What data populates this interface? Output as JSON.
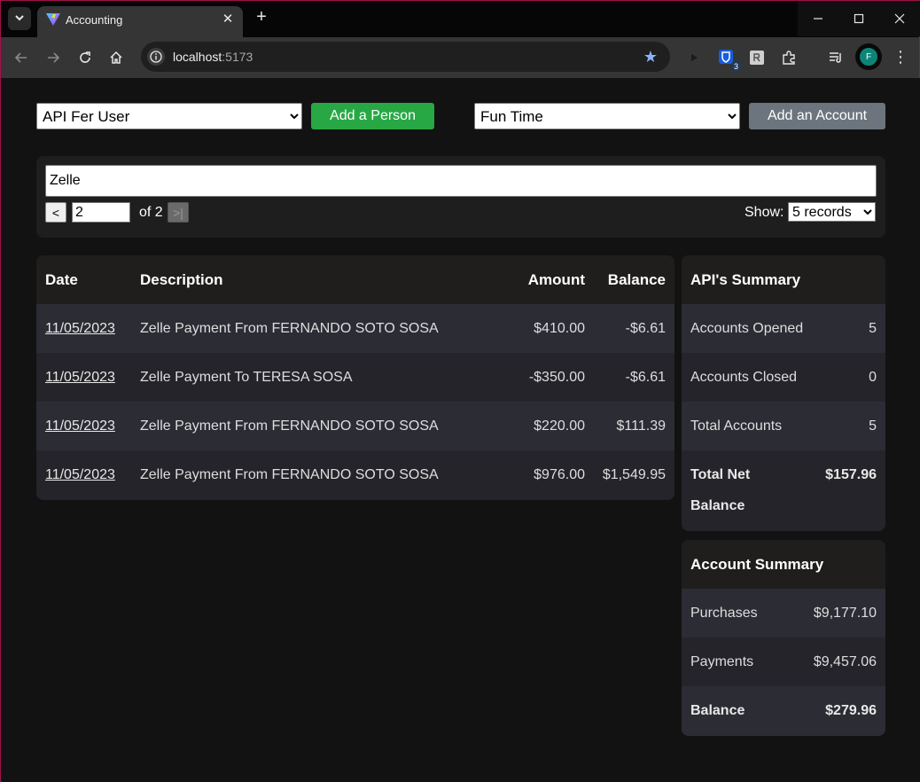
{
  "browser": {
    "tab_title": "Accounting",
    "url_host": "localhost",
    "url_port": ":5173",
    "extension_badge": "3",
    "profile_initial": "F"
  },
  "controls": {
    "person_select": "API Fer User",
    "add_person_label": "Add a Person",
    "account_select": "Fun Time",
    "add_account_label": "Add an Account"
  },
  "filter": {
    "search_value": "Zelle",
    "page_value": "2",
    "prev_label": "<",
    "next_label": ">|",
    "of_text": "of 2",
    "show_label": "Show:",
    "show_select": "5 records"
  },
  "table": {
    "headers": {
      "date": "Date",
      "description": "Description",
      "amount": "Amount",
      "balance": "Balance"
    },
    "rows": [
      {
        "date": "11/05/2023",
        "description": "Zelle Payment From FERNANDO SOTO SOSA",
        "amount": "$410.00",
        "balance": "-$6.61"
      },
      {
        "date": "11/05/2023",
        "description": "Zelle Payment To TERESA SOSA",
        "amount": "-$350.00",
        "balance": "-$6.61"
      },
      {
        "date": "11/05/2023",
        "description": "Zelle Payment From FERNANDO SOTO SOSA",
        "amount": "$220.00",
        "balance": "$111.39"
      },
      {
        "date": "11/05/2023",
        "description": "Zelle Payment From FERNANDO SOTO SOSA",
        "amount": "$976.00",
        "balance": "$1,549.95"
      }
    ]
  },
  "api_summary": {
    "title": "API's Summary",
    "rows": [
      {
        "label": "Accounts Opened",
        "value": "5"
      },
      {
        "label": "Accounts Closed",
        "value": "0"
      },
      {
        "label": "Total Accounts",
        "value": "5"
      }
    ],
    "net_label_line1": "Total Net",
    "net_label_line2": "Balance",
    "net_value": "$157.96"
  },
  "account_summary": {
    "title": "Account Summary",
    "rows": [
      {
        "label": "Purchases",
        "value": "$9,177.10"
      },
      {
        "label": "Payments",
        "value": "$9,457.06"
      }
    ],
    "balance_label": "Balance",
    "balance_value": "$279.96"
  },
  "colors": {
    "accent_green": "#28a745",
    "button_gray": "#6c757d",
    "page_bg": "#121212"
  }
}
